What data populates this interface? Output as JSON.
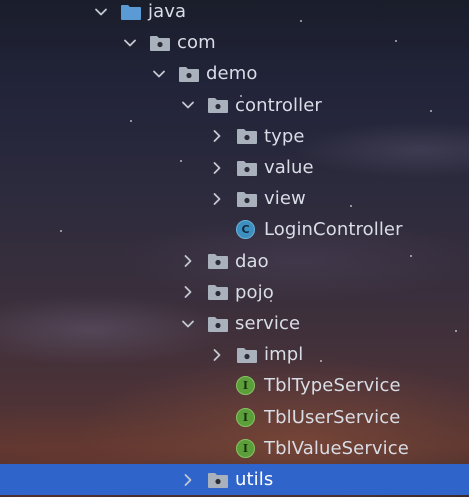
{
  "theme": {
    "selection_color": "#2f65ca",
    "text_color": "#d8dde6",
    "folder_color": "#a9b1bd",
    "java_folder_color": "#5a9bd5",
    "class_icon_color": "#3d8fbf",
    "interface_icon_color": "#5c9e3a"
  },
  "tree": {
    "rows": [
      {
        "label": "java",
        "depth": 0,
        "expander": "expanded",
        "icon": "source-folder-icon",
        "selected": false
      },
      {
        "label": "com",
        "depth": 1,
        "expander": "expanded",
        "icon": "package-icon",
        "selected": false
      },
      {
        "label": "demo",
        "depth": 2,
        "expander": "expanded",
        "icon": "package-icon",
        "selected": false
      },
      {
        "label": "controller",
        "depth": 3,
        "expander": "expanded",
        "icon": "package-icon",
        "selected": false
      },
      {
        "label": "type",
        "depth": 4,
        "expander": "collapsed",
        "icon": "package-icon",
        "selected": false
      },
      {
        "label": "value",
        "depth": 4,
        "expander": "collapsed",
        "icon": "package-icon",
        "selected": false
      },
      {
        "label": "view",
        "depth": 4,
        "expander": "collapsed",
        "icon": "package-icon",
        "selected": false
      },
      {
        "label": "LoginController",
        "depth": 4,
        "expander": "none",
        "icon": "class-icon",
        "selected": false
      },
      {
        "label": "dao",
        "depth": 3,
        "expander": "collapsed",
        "icon": "package-icon",
        "selected": false
      },
      {
        "label": "pojo",
        "depth": 3,
        "expander": "collapsed",
        "icon": "package-icon",
        "selected": false
      },
      {
        "label": "service",
        "depth": 3,
        "expander": "expanded",
        "icon": "package-icon",
        "selected": false
      },
      {
        "label": "impl",
        "depth": 4,
        "expander": "collapsed",
        "icon": "package-icon",
        "selected": false
      },
      {
        "label": "TblTypeService",
        "depth": 4,
        "expander": "none",
        "icon": "interface-icon",
        "selected": false
      },
      {
        "label": "TblUserService",
        "depth": 4,
        "expander": "none",
        "icon": "interface-icon",
        "selected": false
      },
      {
        "label": "TblValueService",
        "depth": 4,
        "expander": "none",
        "icon": "interface-icon",
        "selected": false
      },
      {
        "label": "utils",
        "depth": 3,
        "expander": "collapsed",
        "icon": "package-icon",
        "selected": true
      }
    ],
    "class_badge_letter": "C",
    "interface_badge_letter": "I"
  }
}
